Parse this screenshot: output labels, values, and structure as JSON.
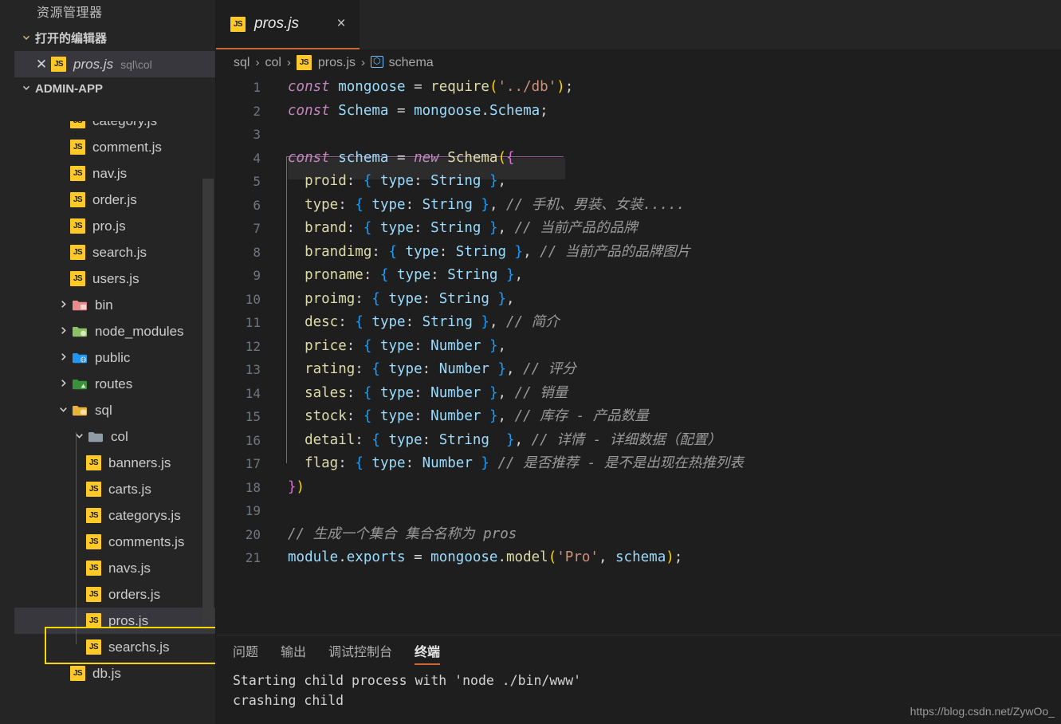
{
  "sidebar": {
    "title": "资源管理器",
    "open_editors": {
      "label": "打开的编辑器",
      "chevron": "chevron-down",
      "items": [
        {
          "name": "pros.js",
          "desc": "sql\\col",
          "icon": "js-file-icon",
          "selected": true
        }
      ]
    },
    "project": {
      "label": "ADMIN-APP",
      "chevron": "chevron-down"
    },
    "tree": [
      {
        "label": "category.js",
        "type": "file",
        "icon": "js-file-icon",
        "indent": 2
      },
      {
        "label": "comment.js",
        "type": "file",
        "icon": "js-file-icon",
        "indent": 2
      },
      {
        "label": "nav.js",
        "type": "file",
        "icon": "js-file-icon",
        "indent": 2
      },
      {
        "label": "order.js",
        "type": "file",
        "icon": "js-file-icon",
        "indent": 2
      },
      {
        "label": "pro.js",
        "type": "file",
        "icon": "js-file-icon",
        "indent": 2
      },
      {
        "label": "search.js",
        "type": "file",
        "icon": "js-file-icon",
        "indent": 2
      },
      {
        "label": "users.js",
        "type": "file",
        "icon": "js-file-icon",
        "indent": 2
      },
      {
        "label": "bin",
        "type": "folder",
        "icon": "folder-icon",
        "expanded": false,
        "indent": 1,
        "color": "#e88b8b"
      },
      {
        "label": "node_modules",
        "type": "folder",
        "icon": "folder-icon",
        "expanded": false,
        "indent": 1,
        "color": "#8cc265"
      },
      {
        "label": "public",
        "type": "folder",
        "icon": "folder-icon",
        "expanded": false,
        "indent": 1,
        "color": "#2196f3"
      },
      {
        "label": "routes",
        "type": "folder",
        "icon": "folder-icon",
        "expanded": false,
        "indent": 1,
        "color": "#3a923a"
      },
      {
        "label": "sql",
        "type": "folder",
        "icon": "folder-icon",
        "expanded": true,
        "indent": 1,
        "color": "#e8b339"
      },
      {
        "label": "col",
        "type": "folder",
        "icon": "folder-icon",
        "expanded": true,
        "indent": 2,
        "color": "#8f9ba6"
      },
      {
        "label": "banners.js",
        "type": "file",
        "icon": "js-file-icon",
        "indent": 3
      },
      {
        "label": "carts.js",
        "type": "file",
        "icon": "js-file-icon",
        "indent": 3
      },
      {
        "label": "categorys.js",
        "type": "file",
        "icon": "js-file-icon",
        "indent": 3
      },
      {
        "label": "comments.js",
        "type": "file",
        "icon": "js-file-icon",
        "indent": 3
      },
      {
        "label": "navs.js",
        "type": "file",
        "icon": "js-file-icon",
        "indent": 3
      },
      {
        "label": "orders.js",
        "type": "file",
        "icon": "js-file-icon",
        "indent": 3
      },
      {
        "label": "pros.js",
        "type": "file",
        "icon": "js-file-icon",
        "indent": 3,
        "selected": true,
        "highlighted": true
      },
      {
        "label": "searchs.js",
        "type": "file",
        "icon": "js-file-icon",
        "indent": 3
      },
      {
        "label": "db.js",
        "type": "file",
        "icon": "js-file-icon",
        "indent": 2
      }
    ]
  },
  "tabs": [
    {
      "label": "pros.js",
      "icon": "js-file-icon",
      "active": true,
      "close": "×"
    }
  ],
  "breadcrumb": {
    "items": [
      "sql",
      "col",
      "pros.js",
      "schema"
    ],
    "separator": "›",
    "file_icon": "js-file-icon",
    "symbol_icon": "namespace-symbol-icon"
  },
  "editor": {
    "lines": [
      {
        "n": "1",
        "tokens": [
          [
            "kw",
            "const"
          ],
          [
            "plain",
            " "
          ],
          [
            "var",
            "mongoose"
          ],
          [
            "plain",
            " "
          ],
          [
            "op",
            "="
          ],
          [
            "plain",
            " "
          ],
          [
            "fn",
            "require"
          ],
          [
            "paren",
            "("
          ],
          [
            "str",
            "'../db'"
          ],
          [
            "paren",
            ")"
          ],
          [
            "plain",
            ";"
          ]
        ]
      },
      {
        "n": "2",
        "tokens": [
          [
            "kw",
            "const"
          ],
          [
            "plain",
            " "
          ],
          [
            "class",
            "Schema"
          ],
          [
            "plain",
            " "
          ],
          [
            "op",
            "="
          ],
          [
            "plain",
            " "
          ],
          [
            "var",
            "mongoose"
          ],
          [
            "plain",
            "."
          ],
          [
            "var",
            "Schema"
          ],
          [
            "plain",
            ";"
          ]
        ]
      },
      {
        "n": "3",
        "tokens": []
      },
      {
        "n": "4",
        "tokens": [
          [
            "kw",
            "const"
          ],
          [
            "plain",
            " "
          ],
          [
            "var",
            "schema"
          ],
          [
            "plain",
            " "
          ],
          [
            "op",
            "="
          ],
          [
            "plain",
            " "
          ],
          [
            "new",
            "new"
          ],
          [
            "plain",
            " "
          ],
          [
            "class2",
            "Schema"
          ],
          [
            "paren",
            "("
          ],
          [
            "paren2",
            "{"
          ]
        ]
      },
      {
        "n": "5",
        "tokens": [
          [
            "plain",
            "  "
          ],
          [
            "prop",
            "proid"
          ],
          [
            "plain",
            ": "
          ],
          [
            "brace",
            "{"
          ],
          [
            "plain",
            " "
          ],
          [
            "prop2",
            "type"
          ],
          [
            "plain",
            ": "
          ],
          [
            "type",
            "String"
          ],
          [
            "plain",
            " "
          ],
          [
            "brace",
            "}"
          ],
          [
            "plain",
            ","
          ]
        ]
      },
      {
        "n": "6",
        "tokens": [
          [
            "plain",
            "  "
          ],
          [
            "prop",
            "type"
          ],
          [
            "plain",
            ": "
          ],
          [
            "brace",
            "{"
          ],
          [
            "plain",
            " "
          ],
          [
            "prop2",
            "type"
          ],
          [
            "plain",
            ": "
          ],
          [
            "type",
            "String"
          ],
          [
            "plain",
            " "
          ],
          [
            "brace",
            "}"
          ],
          [
            "plain",
            ", "
          ],
          [
            "cmt",
            "// 手机、男装、女装....."
          ]
        ]
      },
      {
        "n": "7",
        "tokens": [
          [
            "plain",
            "  "
          ],
          [
            "prop",
            "brand"
          ],
          [
            "plain",
            ": "
          ],
          [
            "brace",
            "{"
          ],
          [
            "plain",
            " "
          ],
          [
            "prop2",
            "type"
          ],
          [
            "plain",
            ": "
          ],
          [
            "type",
            "String"
          ],
          [
            "plain",
            " "
          ],
          [
            "brace",
            "}"
          ],
          [
            "plain",
            ", "
          ],
          [
            "cmt",
            "// 当前产品的品牌"
          ]
        ]
      },
      {
        "n": "8",
        "tokens": [
          [
            "plain",
            "  "
          ],
          [
            "prop",
            "brandimg"
          ],
          [
            "plain",
            ": "
          ],
          [
            "brace",
            "{"
          ],
          [
            "plain",
            " "
          ],
          [
            "prop2",
            "type"
          ],
          [
            "plain",
            ": "
          ],
          [
            "type",
            "String"
          ],
          [
            "plain",
            " "
          ],
          [
            "brace",
            "}"
          ],
          [
            "plain",
            ", "
          ],
          [
            "cmt",
            "// 当前产品的品牌图片"
          ]
        ]
      },
      {
        "n": "9",
        "tokens": [
          [
            "plain",
            "  "
          ],
          [
            "prop",
            "proname"
          ],
          [
            "plain",
            ": "
          ],
          [
            "brace",
            "{"
          ],
          [
            "plain",
            " "
          ],
          [
            "prop2",
            "type"
          ],
          [
            "plain",
            ": "
          ],
          [
            "type",
            "String"
          ],
          [
            "plain",
            " "
          ],
          [
            "brace",
            "}"
          ],
          [
            "plain",
            ","
          ]
        ]
      },
      {
        "n": "10",
        "tokens": [
          [
            "plain",
            "  "
          ],
          [
            "prop",
            "proimg"
          ],
          [
            "plain",
            ": "
          ],
          [
            "brace",
            "{"
          ],
          [
            "plain",
            " "
          ],
          [
            "prop2",
            "type"
          ],
          [
            "plain",
            ": "
          ],
          [
            "type",
            "String"
          ],
          [
            "plain",
            " "
          ],
          [
            "brace",
            "}"
          ],
          [
            "plain",
            ","
          ]
        ]
      },
      {
        "n": "11",
        "tokens": [
          [
            "plain",
            "  "
          ],
          [
            "prop",
            "desc"
          ],
          [
            "plain",
            ": "
          ],
          [
            "brace",
            "{"
          ],
          [
            "plain",
            " "
          ],
          [
            "prop2",
            "type"
          ],
          [
            "plain",
            ": "
          ],
          [
            "type",
            "String"
          ],
          [
            "plain",
            " "
          ],
          [
            "brace",
            "}"
          ],
          [
            "plain",
            ", "
          ],
          [
            "cmt",
            "// 简介"
          ]
        ]
      },
      {
        "n": "12",
        "tokens": [
          [
            "plain",
            "  "
          ],
          [
            "prop",
            "price"
          ],
          [
            "plain",
            ": "
          ],
          [
            "brace",
            "{"
          ],
          [
            "plain",
            " "
          ],
          [
            "prop2",
            "type"
          ],
          [
            "plain",
            ": "
          ],
          [
            "type",
            "Number"
          ],
          [
            "plain",
            " "
          ],
          [
            "brace",
            "}"
          ],
          [
            "plain",
            ","
          ]
        ]
      },
      {
        "n": "13",
        "tokens": [
          [
            "plain",
            "  "
          ],
          [
            "prop",
            "rating"
          ],
          [
            "plain",
            ": "
          ],
          [
            "brace",
            "{"
          ],
          [
            "plain",
            " "
          ],
          [
            "prop2",
            "type"
          ],
          [
            "plain",
            ": "
          ],
          [
            "type",
            "Number"
          ],
          [
            "plain",
            " "
          ],
          [
            "brace",
            "}"
          ],
          [
            "plain",
            ", "
          ],
          [
            "cmt",
            "// 评分"
          ]
        ]
      },
      {
        "n": "14",
        "tokens": [
          [
            "plain",
            "  "
          ],
          [
            "prop",
            "sales"
          ],
          [
            "plain",
            ": "
          ],
          [
            "brace",
            "{"
          ],
          [
            "plain",
            " "
          ],
          [
            "prop2",
            "type"
          ],
          [
            "plain",
            ": "
          ],
          [
            "type",
            "Number"
          ],
          [
            "plain",
            " "
          ],
          [
            "brace",
            "}"
          ],
          [
            "plain",
            ", "
          ],
          [
            "cmt",
            "// 销量"
          ]
        ]
      },
      {
        "n": "15",
        "tokens": [
          [
            "plain",
            "  "
          ],
          [
            "prop",
            "stock"
          ],
          [
            "plain",
            ": "
          ],
          [
            "brace",
            "{"
          ],
          [
            "plain",
            " "
          ],
          [
            "prop2",
            "type"
          ],
          [
            "plain",
            ": "
          ],
          [
            "type",
            "Number"
          ],
          [
            "plain",
            " "
          ],
          [
            "brace",
            "}"
          ],
          [
            "plain",
            ", "
          ],
          [
            "cmt",
            "// 库存 - 产品数量"
          ]
        ]
      },
      {
        "n": "16",
        "tokens": [
          [
            "plain",
            "  "
          ],
          [
            "prop",
            "detail"
          ],
          [
            "plain",
            ": "
          ],
          [
            "brace",
            "{"
          ],
          [
            "plain",
            " "
          ],
          [
            "prop2",
            "type"
          ],
          [
            "plain",
            ": "
          ],
          [
            "type",
            "String"
          ],
          [
            "plain",
            "  "
          ],
          [
            "brace",
            "}"
          ],
          [
            "plain",
            ", "
          ],
          [
            "cmt",
            "// 详情 - 详细数据（配置）"
          ]
        ]
      },
      {
        "n": "17",
        "tokens": [
          [
            "plain",
            "  "
          ],
          [
            "prop",
            "flag"
          ],
          [
            "plain",
            ": "
          ],
          [
            "brace",
            "{"
          ],
          [
            "plain",
            " "
          ],
          [
            "prop2",
            "type"
          ],
          [
            "plain",
            ": "
          ],
          [
            "type",
            "Number"
          ],
          [
            "plain",
            " "
          ],
          [
            "brace",
            "}"
          ],
          [
            "plain",
            " "
          ],
          [
            "cmt",
            "// 是否推荐 - 是不是出现在热推列表"
          ]
        ]
      },
      {
        "n": "18",
        "tokens": [
          [
            "paren2",
            "}"
          ],
          [
            "paren",
            ")"
          ]
        ]
      },
      {
        "n": "19",
        "tokens": []
      },
      {
        "n": "20",
        "tokens": [
          [
            "cmt",
            "// 生成一个集合 集合名称为 pros"
          ]
        ]
      },
      {
        "n": "21",
        "tokens": [
          [
            "var",
            "module"
          ],
          [
            "plain",
            "."
          ],
          [
            "var",
            "exports"
          ],
          [
            "plain",
            " "
          ],
          [
            "op",
            "="
          ],
          [
            "plain",
            " "
          ],
          [
            "var",
            "mongoose"
          ],
          [
            "plain",
            "."
          ],
          [
            "fn",
            "model"
          ],
          [
            "paren",
            "("
          ],
          [
            "str",
            "'Pro'"
          ],
          [
            "plain",
            ", "
          ],
          [
            "var",
            "schema"
          ],
          [
            "paren",
            ")"
          ],
          [
            "plain",
            ";"
          ]
        ]
      }
    ]
  },
  "panel": {
    "tabs": [
      {
        "label": "问题",
        "active": false
      },
      {
        "label": "输出",
        "active": false
      },
      {
        "label": "调试控制台",
        "active": false
      },
      {
        "label": "终端",
        "active": true
      }
    ],
    "terminal_lines": [
      "Starting child process with 'node ./bin/www'",
      "crashing child"
    ]
  },
  "watermark": "https://blog.csdn.net/ZywOo_",
  "colors": {
    "accent": "#cc6633",
    "highlight": "#f5d800",
    "sidebar_bg": "#252526",
    "editor_bg": "#1e1e1e",
    "selected_row": "#37373d"
  }
}
